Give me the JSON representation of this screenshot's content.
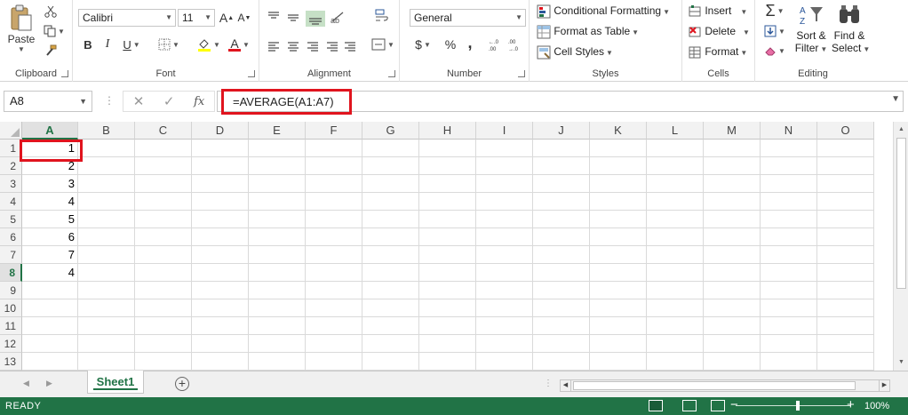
{
  "ribbon": {
    "clipboard": {
      "paste_label": "Paste",
      "group_label": "Clipboard"
    },
    "font": {
      "font_name": "Calibri",
      "font_size": "11",
      "bold": "B",
      "italic": "I",
      "underline": "U",
      "grow": "A",
      "shrink": "A",
      "font_color_glyph": "A",
      "group_label": "Font"
    },
    "alignment": {
      "group_label": "Alignment"
    },
    "number": {
      "format": "General",
      "currency": "$",
      "percent": "%",
      "comma": ",",
      "group_label": "Number"
    },
    "styles": {
      "conditional": "Conditional Formatting",
      "format_table": "Format as Table",
      "cell_styles": "Cell Styles",
      "group_label": "Styles"
    },
    "cells": {
      "insert": "Insert",
      "delete": "Delete",
      "format": "Format",
      "group_label": "Cells"
    },
    "editing": {
      "sort_line1": "Sort &",
      "sort_line2": "Filter",
      "find_line1": "Find &",
      "find_line2": "Select",
      "sum_glyph": "Σ",
      "group_label": "Editing"
    }
  },
  "formula_bar": {
    "name_box": "A8",
    "formula": "=AVERAGE(A1:A7)"
  },
  "grid": {
    "columns": [
      "A",
      "B",
      "C",
      "D",
      "E",
      "F",
      "G",
      "H",
      "I",
      "J",
      "K",
      "L",
      "M",
      "N",
      "O"
    ],
    "rows": [
      "1",
      "2",
      "3",
      "4",
      "5",
      "6",
      "7",
      "8",
      "9",
      "10",
      "11",
      "12",
      "13"
    ],
    "active_col": "A",
    "active_row": "8",
    "col_a_values": [
      "1",
      "2",
      "3",
      "4",
      "5",
      "6",
      "7",
      "4"
    ]
  },
  "sheet_tabs": {
    "active": "Sheet1"
  },
  "status": {
    "text": "READY",
    "zoom": "100%"
  },
  "colors": {
    "accent": "#217346",
    "highlight": "#e0141e"
  }
}
